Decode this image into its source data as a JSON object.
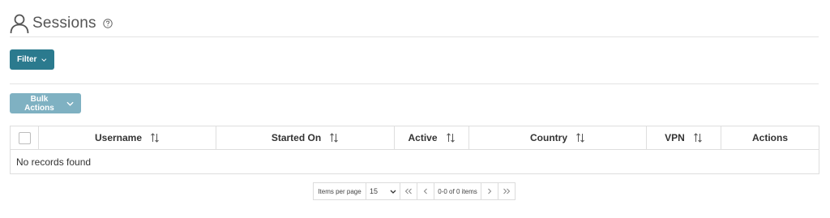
{
  "header": {
    "title": "Sessions",
    "icon": "user-icon",
    "help_icon": "help-circle-icon"
  },
  "toolbar": {
    "filter_label": "Filter",
    "bulk_actions_label": "Bulk Actions"
  },
  "table": {
    "columns": [
      {
        "label": "Username",
        "sortable": true
      },
      {
        "label": "Started On",
        "sortable": true
      },
      {
        "label": "Active",
        "sortable": true
      },
      {
        "label": "Country",
        "sortable": true
      },
      {
        "label": "VPN",
        "sortable": true
      },
      {
        "label": "Actions",
        "sortable": false
      }
    ],
    "empty_message": "No records found"
  },
  "pagination": {
    "items_per_page_label": "Items per page",
    "page_size": "15",
    "info": "0-0 of 0 items"
  },
  "colors": {
    "primary": "#2b7a8e",
    "primary_disabled": "#7fb1c2",
    "border": "#dedede"
  }
}
